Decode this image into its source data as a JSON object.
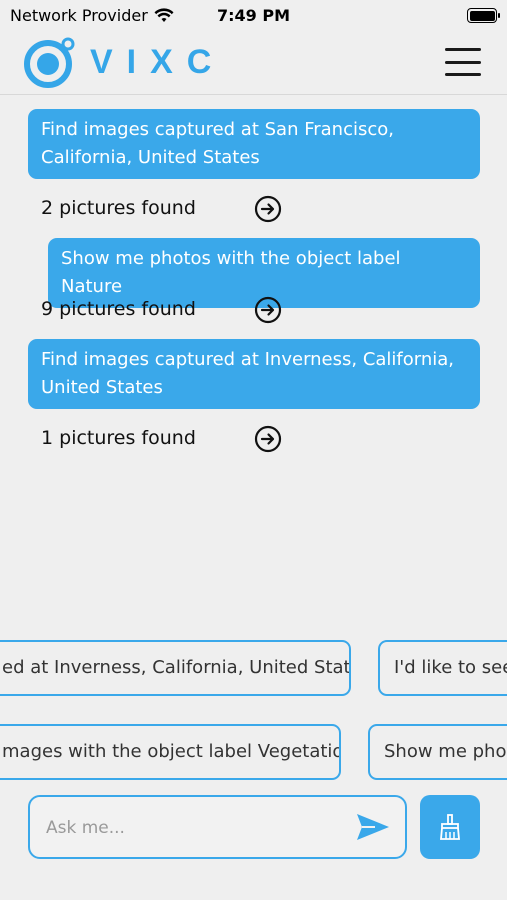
{
  "status": {
    "carrier": "Network Provider",
    "time": "7:49 PM",
    "icons": [
      "wifi-icon",
      "battery-icon"
    ]
  },
  "header": {
    "logo_text": "VIXC",
    "menu_icon": "hamburger-menu-icon"
  },
  "colors": {
    "accent": "#3aa8ea",
    "background": "#efefef"
  },
  "chat": {
    "messages": [
      {
        "query": "Find images captured at San Francisco, California, United States",
        "result": "2 pictures found"
      },
      {
        "query": "Show me photos with the object label Nature",
        "result": "9 pictures found"
      },
      {
        "query": "Find images captured at Inverness, California, United States",
        "result": "1 pictures found"
      }
    ]
  },
  "suggestions": {
    "row1": [
      "ed at Inverness, California, United States",
      "I'd like to see p"
    ],
    "row2": [
      "mages with the object label Vegetation",
      "Show me photo"
    ]
  },
  "composer": {
    "placeholder": "Ask me...",
    "send_icon": "send-icon",
    "clear_icon": "broom-icon"
  }
}
